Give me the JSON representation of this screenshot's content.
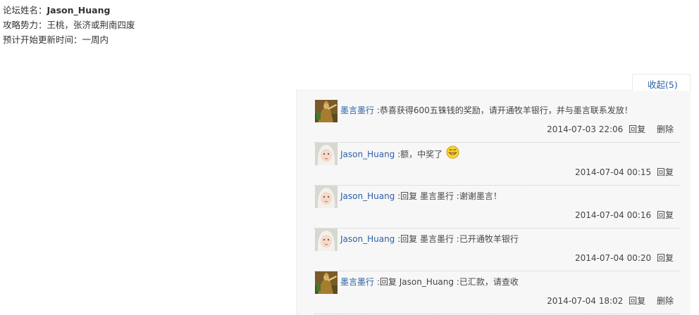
{
  "post_info": {
    "forum_name_label": "论坛姓名：",
    "forum_name_value": "Jason_Huang",
    "strategy_force": "攻略势力：王桃，张济或荆南四废",
    "update_time": "预计开始更新时间：一周内"
  },
  "collapse_label": "收起(5)",
  "comments": [
    {
      "user": "墨言墨行",
      "text": ":恭喜获得600五铢钱的奖励，请开通牧羊银行，并与墨言联系发放！",
      "time": "2014-07-03 22:06",
      "reply_label": "回复",
      "delete_label": "删除"
    },
    {
      "user": "Jason_Huang",
      "text": ":额，中奖了",
      "time": "2014-07-04 00:15",
      "reply_label": "回复"
    },
    {
      "user": "Jason_Huang",
      "text": ":回复 墨言墨行 :谢谢墨言！",
      "time": "2014-07-04 00:16",
      "reply_label": "回复"
    },
    {
      "user": "Jason_Huang",
      "text": ":回复 墨言墨行 :已开通牧羊银行",
      "time": "2014-07-04 00:20",
      "reply_label": "回复"
    },
    {
      "user": "墨言墨行",
      "text": ":回复 Jason_Huang :已汇款，请查收",
      "time": "2014-07-04 18:02",
      "reply_label": "回复",
      "delete_label": "删除"
    }
  ]
}
